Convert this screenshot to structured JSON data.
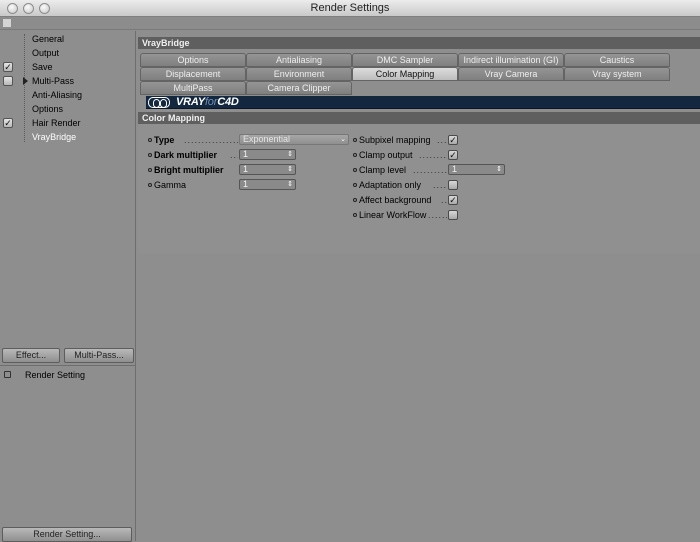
{
  "window": {
    "title": "Render Settings"
  },
  "sidebar": {
    "items": [
      {
        "label": "General",
        "checked": null
      },
      {
        "label": "Output",
        "checked": null
      },
      {
        "label": "Save",
        "checked": true
      },
      {
        "label": "Multi-Pass",
        "checked": false,
        "expandable": true
      },
      {
        "label": "Anti-Aliasing",
        "checked": null
      },
      {
        "label": "Options",
        "checked": null
      },
      {
        "label": "Hair Render",
        "checked": true
      },
      {
        "label": "VrayBridge",
        "checked": null,
        "selected": true
      }
    ],
    "effect_button": "Effect...",
    "multipass_button": "Multi-Pass...",
    "preset_item": "Render Setting",
    "render_setting_button": "Render Setting..."
  },
  "panel": {
    "title": "VrayBridge",
    "tabs_row1": [
      "Options",
      "Antialiasing",
      "DMC Sampler",
      "Indirect illumination (GI)",
      "Caustics"
    ],
    "tabs_row2": [
      "Displacement",
      "Environment",
      "Color Mapping",
      "Vray Camera",
      "Vray system"
    ],
    "tabs_row3": [
      "MultiPass",
      "Camera Clipper"
    ],
    "active_tab": "Color Mapping",
    "banner": {
      "part1": "VRAY",
      "part2": "for",
      "part3": "C4D"
    },
    "section_title": "Color Mapping"
  },
  "params": {
    "type": {
      "label": "Type",
      "value": "Exponential"
    },
    "dark_multiplier": {
      "label": "Dark multiplier",
      "value": "1"
    },
    "bright_multiplier": {
      "label": "Bright multiplier",
      "value": "1"
    },
    "gamma": {
      "label": "Gamma",
      "value": "1"
    },
    "subpixel_mapping": {
      "label": "Subpixel mapping",
      "checked": true
    },
    "clamp_output": {
      "label": "Clamp output",
      "checked": true
    },
    "clamp_level": {
      "label": "Clamp level",
      "value": "1"
    },
    "adaptation_only": {
      "label": "Adaptation only",
      "checked": false
    },
    "affect_background": {
      "label": "Affect background",
      "checked": true
    },
    "linear_workflow": {
      "label": "Linear WorkFlow",
      "checked": false
    }
  },
  "glyphs": {
    "check": "✓",
    "spin": "⇕",
    "dropdown": "⌄",
    "dots_short": "............",
    "dots_long": "................"
  }
}
